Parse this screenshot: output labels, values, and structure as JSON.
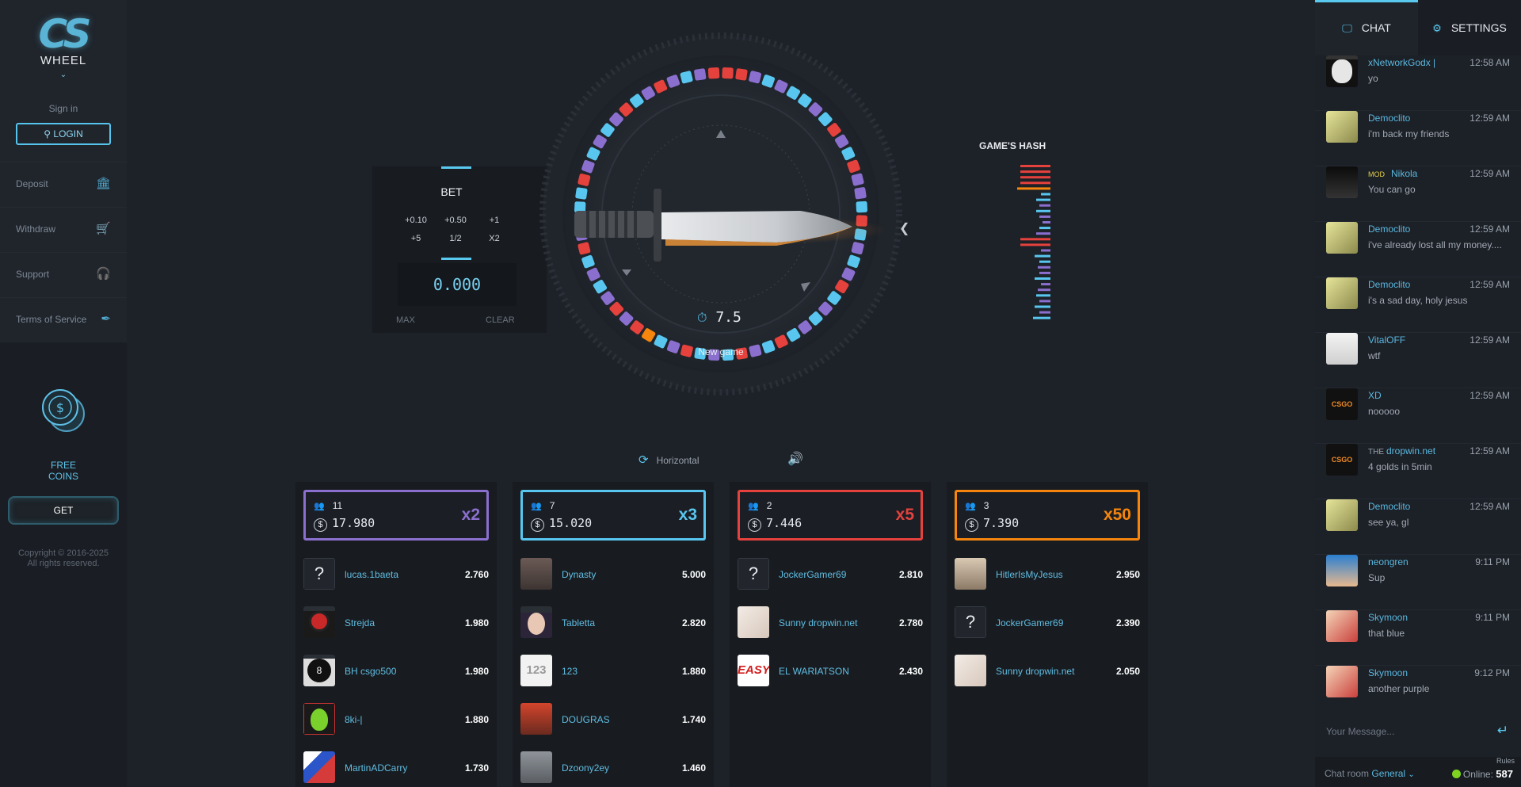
{
  "brand": {
    "logo_text": "CS",
    "logo_sub": "WHEEL"
  },
  "sidebar": {
    "signin": "Sign in",
    "login": "LOGIN",
    "items": [
      {
        "label": "Deposit",
        "icon": "bank-icon"
      },
      {
        "label": "Withdraw",
        "icon": "cart-icon"
      },
      {
        "label": "Support",
        "icon": "headset-icon"
      },
      {
        "label": "Terms of Service",
        "icon": "feather-icon"
      }
    ],
    "free_coins_line1": "FREE",
    "free_coins_line2": "COINS",
    "get": "GET",
    "copyright_line1": "Copyright © 2016-2025",
    "copyright_line2": "All rights reserved."
  },
  "bet": {
    "title": "BET",
    "quick": [
      "+0.10",
      "+0.50",
      "+1",
      "+5",
      "1/2",
      "X2"
    ],
    "value": "0.000",
    "max": "MAX",
    "clear": "CLEAR"
  },
  "game": {
    "timer": "7.5",
    "status": "New game",
    "hash_title": "GAME'S HASH",
    "view_mode": "Horizontal",
    "colors": {
      "purple": "#8b6fcf",
      "blue": "#58c6ef",
      "red": "#e5413d",
      "orange": "#f5850d"
    }
  },
  "columns": [
    {
      "count": "11",
      "total": "17.980",
      "multiplier": "x2",
      "color": "#8b6fcf",
      "bets": [
        {
          "name": "lucas.1baeta",
          "amount": "2.760",
          "avatar": "question"
        },
        {
          "name": "Strejda",
          "amount": "1.980",
          "avatar": "joker"
        },
        {
          "name": "BH csgo500",
          "amount": "1.980",
          "avatar": "eightball"
        },
        {
          "name": "8ki-|",
          "amount": "1.880",
          "avatar": "alien"
        },
        {
          "name": "MartinADCarry",
          "amount": "1.730",
          "avatar": "flag"
        }
      ]
    },
    {
      "count": "7",
      "total": "15.020",
      "multiplier": "x3",
      "color": "#58c6ef",
      "bets": [
        {
          "name": "Dynasty",
          "amount": "5.000",
          "avatar": "photo"
        },
        {
          "name": "Tabletta",
          "amount": "2.820",
          "avatar": "face"
        },
        {
          "name": "123",
          "amount": "1.880",
          "avatar": "text123"
        },
        {
          "name": "DOUGRAS",
          "amount": "1.740",
          "avatar": "red"
        },
        {
          "name": "Dzoony2ey",
          "amount": "1.460",
          "avatar": "gray"
        }
      ]
    },
    {
      "count": "2",
      "total": "7.446",
      "multiplier": "x5",
      "color": "#e5413d",
      "bets": [
        {
          "name": "JockerGamer69",
          "amount": "2.810",
          "avatar": "question"
        },
        {
          "name": "Sunny dropwin.net",
          "amount": "2.780",
          "avatar": "skin"
        },
        {
          "name": "EL WARIATSON",
          "amount": "2.430",
          "avatar": "easy"
        }
      ]
    },
    {
      "count": "3",
      "total": "7.390",
      "multiplier": "x50",
      "color": "#f5850d",
      "bets": [
        {
          "name": "HitlerIsMyJesus",
          "amount": "2.950",
          "avatar": "portrait"
        },
        {
          "name": "JockerGamer69",
          "amount": "2.390",
          "avatar": "question"
        },
        {
          "name": "Sunny dropwin.net",
          "amount": "2.050",
          "avatar": "skin"
        }
      ]
    }
  ],
  "chat": {
    "tab_chat": "CHAT",
    "tab_settings": "SETTINGS",
    "messages": [
      {
        "user": "xNetworkGodx |",
        "time": "12:58 AM",
        "text": "yo",
        "avatar": "anon"
      },
      {
        "user": "Democlito",
        "time": "12:59 AM",
        "text": "i'm back my friends",
        "avatar": "yellow"
      },
      {
        "user": "Nikola",
        "badge": "MOD",
        "time": "12:59 AM",
        "text": "You can go",
        "avatar": "dark"
      },
      {
        "user": "Democlito",
        "time": "12:59 AM",
        "text": "i've already lost all my money....",
        "avatar": "yellow"
      },
      {
        "user": "Democlito",
        "time": "12:59 AM",
        "text": "i's a sad day, holy jesus",
        "avatar": "yellow"
      },
      {
        "user": "VitalOFF",
        "time": "12:59 AM",
        "text": "wtf",
        "avatar": "white"
      },
      {
        "user": "XD",
        "time": "12:59 AM",
        "text": "nooooo",
        "avatar": "csgo"
      },
      {
        "user": "dropwin.net",
        "prefix": "THE",
        "time": "12:59 AM",
        "text": "4 golds in 5min",
        "avatar": "csgo"
      },
      {
        "user": "Democlito",
        "time": "12:59 AM",
        "text": "see ya, gl",
        "avatar": "yellow"
      },
      {
        "user": "neongren",
        "time": "9:11 PM",
        "text": "Sup",
        "avatar": "blue"
      },
      {
        "user": "Skymoon",
        "time": "9:11 PM",
        "text": "that blue",
        "avatar": "anime"
      },
      {
        "user": "Skymoon",
        "time": "9:12 PM",
        "text": "another purple",
        "avatar": "anime"
      }
    ],
    "input_placeholder": "Your Message...",
    "room_label": "Chat room",
    "room": "General",
    "rules": "Rules",
    "online_label": "Online:",
    "online_count": "587"
  }
}
